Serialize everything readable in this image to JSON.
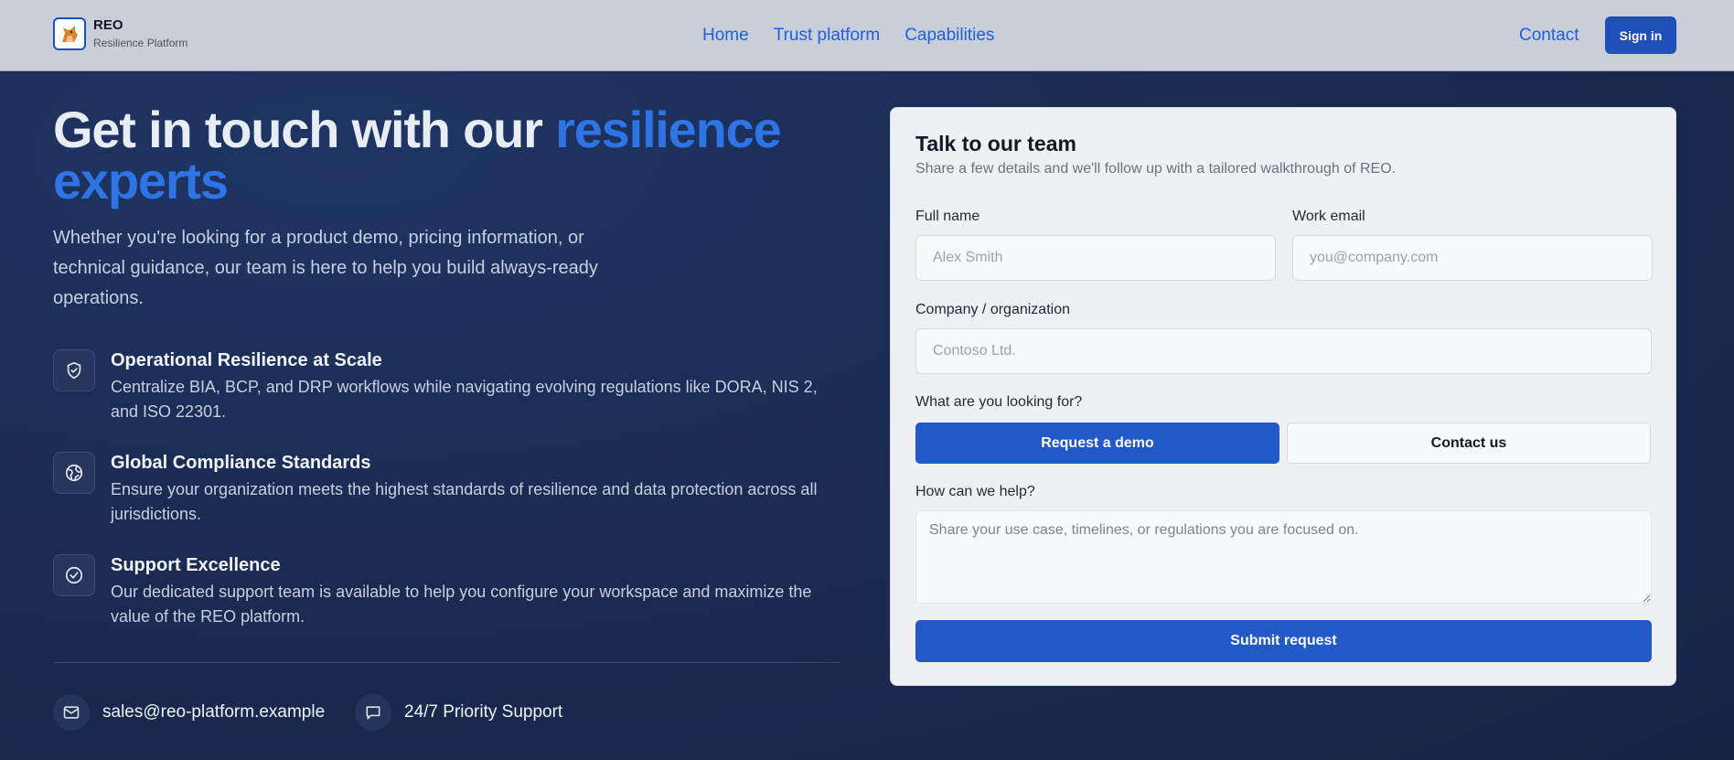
{
  "header": {
    "brand_name": "REO",
    "brand_sub": "Resilience Platform",
    "nav": [
      "Home",
      "Trust platform",
      "Capabilities"
    ],
    "contact_label": "Contact",
    "signin_label": "Sign in"
  },
  "hero": {
    "title_plain": "Get in touch with our ",
    "title_accent": "resilience experts",
    "description": "Whether you're looking for a product demo, pricing information, or technical guidance, our team is here to help you build always-ready operations."
  },
  "features": [
    {
      "icon": "shield-check-icon",
      "title": "Operational Resilience at Scale",
      "description": "Centralize BIA, BCP, and DRP workflows while navigating evolving regulations like DORA, NIS 2, and ISO 22301."
    },
    {
      "icon": "globe-icon",
      "title": "Global Compliance Standards",
      "description": "Ensure your organization meets the highest standards of resilience and data protection across all jurisdictions."
    },
    {
      "icon": "check-circle-icon",
      "title": "Support Excellence",
      "description": "Our dedicated support team is available to help you configure your workspace and maximize the value of the REO platform."
    }
  ],
  "contact_info": {
    "email": "sales@reo-platform.example",
    "support": "24/7 Priority Support"
  },
  "form": {
    "title": "Talk to our team",
    "subtitle": "Share a few details and we'll follow up with a tailored walkthrough of REO.",
    "full_name_label": "Full name",
    "full_name_placeholder": "Alex Smith",
    "full_name_value": "",
    "email_label": "Work email",
    "email_placeholder": "you@company.com",
    "email_value": "",
    "company_label": "Company / organization",
    "company_placeholder": "Contoso Ltd.",
    "company_value": "",
    "looking_for_label": "What are you looking for?",
    "options": [
      "Request a demo",
      "Contact us"
    ],
    "selected_option": "Request a demo",
    "help_label": "How can we help?",
    "help_placeholder": "Share your use case, timelines, or regulations you are focused on.",
    "help_value": "",
    "submit_label": "Submit request"
  },
  "colors": {
    "accent": "#2f74e6",
    "primary_button": "#2258c8",
    "header_bg": "#c9ced8",
    "page_bg": "#1b2b52"
  }
}
